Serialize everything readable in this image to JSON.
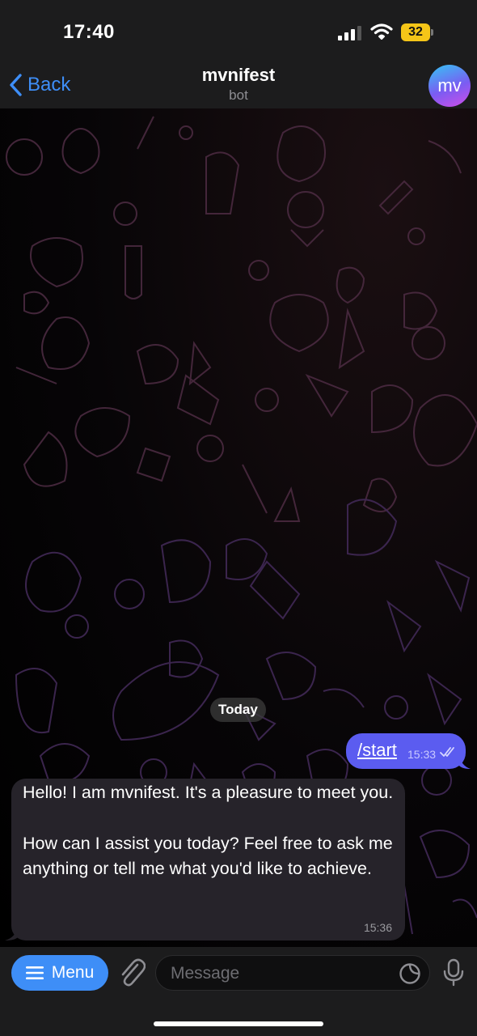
{
  "status_bar": {
    "time": "17:40",
    "battery": "32",
    "icons": [
      "cellular-signal-icon",
      "wifi-icon",
      "battery-icon"
    ]
  },
  "header": {
    "back_label": "Back",
    "title": "mvnifest",
    "subtitle": "bot",
    "avatar_initials": "mv"
  },
  "chat": {
    "date_separator": "Today",
    "messages": [
      {
        "direction": "outgoing",
        "text": "/start",
        "time": "15:33",
        "status": "read"
      },
      {
        "direction": "incoming",
        "paragraphs": [
          "Hello! I am mvnifest. It's a pleasure to meet you.",
          "How can I assist you today? Feel free to ask me anything or tell me what you'd like to achieve."
        ],
        "time": "15:36"
      }
    ]
  },
  "input_bar": {
    "menu_label": "Menu",
    "placeholder": "Message"
  },
  "colors": {
    "accent": "#3e8ef7",
    "outgoing_bubble": "#5b5cf0",
    "incoming_bubble": "#26232a",
    "battery": "#f5c518"
  }
}
